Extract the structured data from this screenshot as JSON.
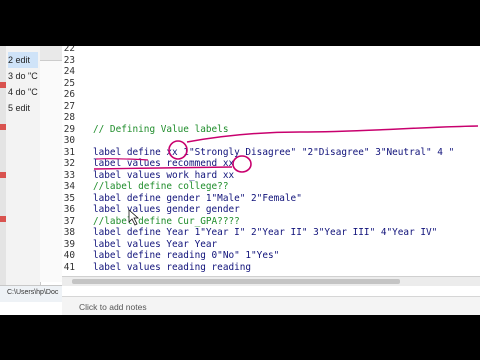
{
  "sidebar": {
    "commands": [
      "2 edit",
      "3 do \"C",
      "4 do \"C",
      "5 edit"
    ],
    "selected_index": 0
  },
  "editor": {
    "lines": [
      {
        "no": "22",
        "text": ""
      },
      {
        "no": "23",
        "text": ""
      },
      {
        "no": "24",
        "text": ""
      },
      {
        "no": "25",
        "text": ""
      },
      {
        "no": "26",
        "text": ""
      },
      {
        "no": "27",
        "text": ""
      },
      {
        "no": "28",
        "text": ""
      },
      {
        "no": "29",
        "text": "// Defining Value labels"
      },
      {
        "no": "30",
        "text": ""
      },
      {
        "no": "31",
        "text": "label define xx 1\"Strongly Disagree\" \"2\"Disagree\" 3\"Neutral\" 4 \""
      },
      {
        "no": "32",
        "text": "label values recommend xx"
      },
      {
        "no": "33",
        "text": "label values work_hard xx"
      },
      {
        "no": "34",
        "text": "//label define college??"
      },
      {
        "no": "35",
        "text": "label define gender 1\"Male\" 2\"Female\""
      },
      {
        "no": "36",
        "text": "label values gender gender"
      },
      {
        "no": "37",
        "text": "//label define Cur_GPA????"
      },
      {
        "no": "38",
        "text": "label define Year 1\"Year I\" 2\"Year II\" 3\"Year III\" 4\"Year IV\""
      },
      {
        "no": "39",
        "text": "label values Year Year"
      },
      {
        "no": "40",
        "text": "label define reading 0\"No\" 1\"Yes\""
      },
      {
        "no": "41",
        "text": "label values reading reading"
      }
    ]
  },
  "status": {
    "path": "C:\\Users\\hp\\Doc",
    "notes_placeholder": "Click to add notes"
  },
  "colors": {
    "comment": "#1f8d2b",
    "code": "#10127a",
    "annotation": "#c8006e"
  }
}
